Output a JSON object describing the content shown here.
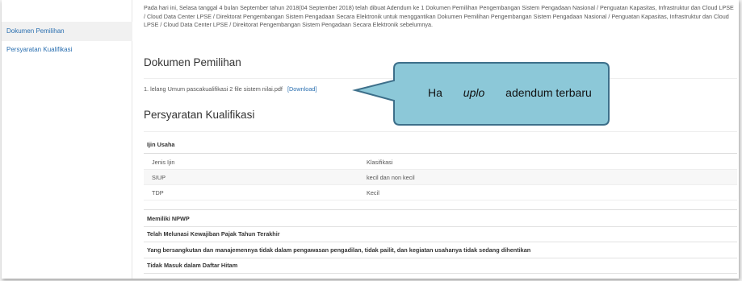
{
  "sidebar": {
    "items": [
      {
        "label": "Dokumen Pemilihan"
      },
      {
        "label": "Persyaratan Kualifikasi"
      }
    ]
  },
  "main": {
    "intro_text": "Pada hari ini, Selasa tanggal 4 bulan September tahun 2018(04 September 2018) telah dibuat Adendum ke 1 Dokumen Pemilihan Pengembangan Sistem Pengadaan Nasional / Penguatan Kapasitas, Infrastruktur dan Cloud LPSE / Cloud Data Center LPSE / Direktorat Pengembangan Sistem Pengadaan Secara Elektronik untuk menggantikan Dokumen Pemilihan Pengembangan Sistem Pengadaan Nasional / Penguatan Kapasitas, Infrastruktur dan Cloud LPSE / Cloud Data Center LPSE / Direktorat Pengembangan Sistem Pengadaan Secara Elektronik sebelumnya.",
    "doc_heading": "Dokumen Pemilihan",
    "doc_file": "1. lelang Umum pascakualifikasi 2 file sistem nilai.pdf",
    "download_label": "[Download]",
    "req_heading": "Persyaratan Kualifikasi",
    "ijin_heading": "Ijin Usaha",
    "ijin_rows": [
      {
        "jenis": "Jenis Ijin",
        "klas": "Klasifikasi"
      },
      {
        "jenis": "SIUP",
        "klas": "kecil dan non kecil"
      },
      {
        "jenis": "TDP",
        "klas": "Kecil"
      }
    ],
    "requirements": [
      "Memiliki NPWP",
      "Telah Melunasi Kewajiban Pajak Tahun Terakhir",
      "Yang bersangkutan dan manajemennya tidak dalam pengawasan pengadilan, tidak pailit, dan kegiatan usahanya tidak sedang dihentikan",
      "Tidak Masuk dalam Daftar Hitam"
    ]
  },
  "callout": {
    "part1": "Ha",
    "part2": "uplo",
    "part3": "adendum terbaru",
    "fill_color": "#8cc8d8",
    "border_color": "#3d6f8a"
  }
}
